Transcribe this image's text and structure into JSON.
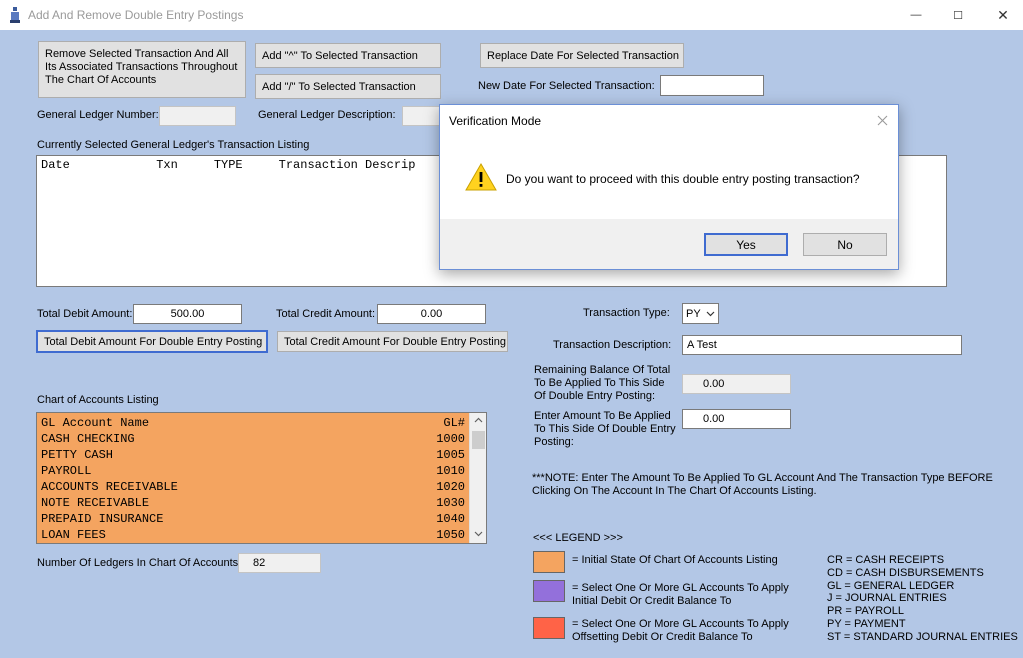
{
  "window": {
    "title": "Add And Remove Double Entry Postings",
    "minimize_glyph": "—",
    "maximize_glyph": "☐",
    "close_glyph": "✕"
  },
  "buttons": {
    "remove_selected": "Remove Selected Transaction And All Its Associated Transactions Throughout The Chart Of Accounts",
    "add_caret": "Add \"^\" To Selected Transaction",
    "add_slash": "Add \"/\" To Selected Transaction",
    "replace_date": "Replace Date For Selected Transaction",
    "total_debit_btn": "Total Debit Amount For Double Entry Posting",
    "total_credit_btn": "Total Credit Amount For Double Entry Posting"
  },
  "labels": {
    "new_date": "New Date For Selected Transaction:",
    "gl_number": "General Ledger Number:",
    "gl_description": "General Ledger Description:",
    "txn_listing": "Currently Selected General Ledger's Transaction Listing",
    "total_debit": "Total Debit Amount:",
    "total_credit": "Total Credit Amount:",
    "txn_type": "Transaction Type:",
    "txn_description": "Transaction Description:",
    "remaining_balance": "Remaining Balance Of Total To Be Applied To This Side Of Double Entry Posting:",
    "enter_amount": "Enter Amount To Be Applied To This Side Of Double Entry Posting:",
    "note": "***NOTE: Enter The Amount To Be Applied To GL Account And The Transaction Type BEFORE Clicking On The Account In The Chart Of Accounts Listing.",
    "coa_listing": "Chart of Accounts Listing",
    "num_ledgers": "Number Of Ledgers In Chart Of Accounts:"
  },
  "fields": {
    "new_date": "",
    "gl_number": "",
    "gl_description": "",
    "total_debit": "500.00",
    "total_credit": "0.00",
    "txn_type": "PY",
    "txn_description": "A Test",
    "remaining_balance": "0.00",
    "enter_amount": "0.00",
    "num_ledgers": "82"
  },
  "txn_listing_header": "Date            Txn     TYPE     Transaction Descrip",
  "chart_of_accounts": {
    "header": {
      "name": "GL Account Name",
      "gl": "GL#"
    },
    "rows": [
      {
        "name": "CASH CHECKING",
        "gl": "1000"
      },
      {
        "name": "PETTY CASH",
        "gl": "1005"
      },
      {
        "name": "PAYROLL",
        "gl": "1010"
      },
      {
        "name": "ACCOUNTS RECEIVABLE",
        "gl": "1020"
      },
      {
        "name": "NOTE RECEIVABLE",
        "gl": "1030"
      },
      {
        "name": "PREPAID INSURANCE",
        "gl": "1040"
      },
      {
        "name": "LOAN FEES",
        "gl": "1050"
      }
    ]
  },
  "legend": {
    "title": "<<< LEGEND >>>",
    "items": [
      {
        "color": "#f4a460",
        "text": "= Initial State Of Chart Of Accounts Listing"
      },
      {
        "color": "#9370db",
        "text": "= Select One Or More GL Accounts To Apply Initial Debit Or Credit Balance To"
      },
      {
        "color": "#ff6347",
        "text": "= Select One Or More GL Accounts To Apply Offsetting Debit Or Credit Balance To"
      }
    ],
    "codes": [
      "CR = CASH RECEIPTS",
      "CD = CASH DISBURSEMENTS",
      "GL = GENERAL LEDGER",
      "J = JOURNAL ENTRIES",
      "PR = PAYROLL",
      "PY = PAYMENT",
      "ST = STANDARD JOURNAL ENTRIES"
    ]
  },
  "dialog": {
    "title": "Verification Mode",
    "message": "Do you want to proceed with this double entry posting transaction?",
    "yes": "Yes",
    "no": "No",
    "icon": "warning-icon"
  },
  "colors": {
    "form_bg": "#b3c7e6",
    "coa_initial": "#f4a460",
    "coa_initial_select": "#9370db",
    "coa_offset_select": "#ff6347",
    "focus_border": "#3f6bd0"
  }
}
